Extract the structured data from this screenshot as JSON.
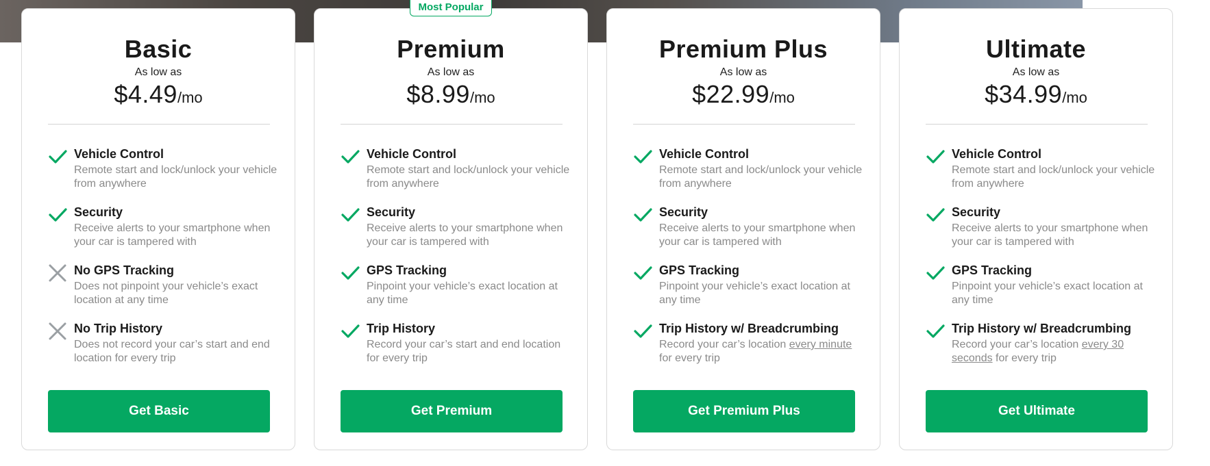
{
  "badge": "Most Popular",
  "price_prefix": "As low as",
  "per_month": "/mo",
  "plans": [
    {
      "name": "Basic",
      "price": "$4.49",
      "cta": "Get Basic",
      "features": [
        {
          "title": "Vehicle Control",
          "desc": "Remote start and lock/unlock your vehicle from anywhere",
          "included": true
        },
        {
          "title": "Security",
          "desc": "Receive alerts to your smartphone when your car is tampered with",
          "included": true
        },
        {
          "title": "No GPS Tracking",
          "desc": "Does not pinpoint your vehicle’s exact location at any time",
          "included": false
        },
        {
          "title": "No Trip History",
          "desc": "Does not record your car’s start and end location for every trip",
          "included": false
        }
      ]
    },
    {
      "name": "Premium",
      "price": "$8.99",
      "cta": "Get Premium",
      "features": [
        {
          "title": "Vehicle Control",
          "desc": "Remote start and lock/unlock your vehicle from anywhere",
          "included": true
        },
        {
          "title": "Security",
          "desc": "Receive alerts to your smartphone when your car is tampered with",
          "included": true
        },
        {
          "title": "GPS Tracking",
          "desc": "Pinpoint your vehicle’s exact location at any time",
          "included": true
        },
        {
          "title": "Trip History",
          "desc": "Record your car’s start and end location for every trip",
          "included": true
        }
      ]
    },
    {
      "name": "Premium Plus",
      "price": "$22.99",
      "cta": "Get Premium Plus",
      "features": [
        {
          "title": "Vehicle Control",
          "desc": "Remote start and lock/unlock your vehicle from anywhere",
          "included": true
        },
        {
          "title": "Security",
          "desc": "Receive alerts to your smartphone when your car is tampered with",
          "included": true
        },
        {
          "title": "GPS Tracking",
          "desc": "Pinpoint your vehicle’s exact location at any time",
          "included": true
        },
        {
          "title": "Trip History w/ Breadcrumbing",
          "desc_before": "Record your car’s location ",
          "desc_link": "every minute",
          "desc_after": " for every trip",
          "included": true
        }
      ]
    },
    {
      "name": "Ultimate",
      "price": "$34.99",
      "cta": "Get Ultimate",
      "features": [
        {
          "title": "Vehicle Control",
          "desc": "Remote start and lock/unlock your vehicle from anywhere",
          "included": true
        },
        {
          "title": "Security",
          "desc": "Receive alerts to your smartphone when your car is tampered with",
          "included": true
        },
        {
          "title": "GPS Tracking",
          "desc": "Pinpoint your vehicle’s exact location at any time",
          "included": true
        },
        {
          "title": "Trip History w/ Breadcrumbing",
          "desc_before": "Record your car’s location ",
          "desc_link": "every 30 seconds",
          "desc_after": " for every trip",
          "included": true
        }
      ]
    }
  ],
  "colors": {
    "accent": "#05a862",
    "check": "#05a862",
    "cross": "#9a9fa3"
  },
  "icons": {
    "included": "check-icon",
    "excluded": "x-icon"
  }
}
